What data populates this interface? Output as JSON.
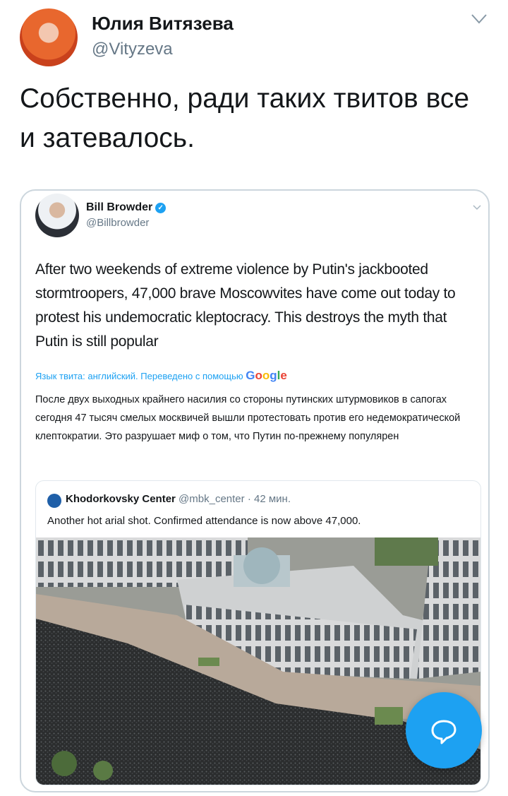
{
  "tweet": {
    "author_name": "Юлия Витязева",
    "author_handle": "@Vityzeva",
    "text": "Собственно, ради таких твитов все и затевалось."
  },
  "quoted": {
    "author_name": "Bill Browder",
    "author_handle": "@Billbrowder",
    "text": "After two weekends of extreme violence by Putin's jackbooted stormtroopers, 47,000 brave Moscowvites have come out today to protest his undemocratic kleptocracy. This destroys the myth that Putin is still popular",
    "translate_label": "Язык твита: английский. Переведено с помощью",
    "translate_provider": "Google",
    "translation": "После двух выходных крайнего насилия со стороны путинских штурмовиков в сапогах сегодня 47 тысяч смелых москвичей вышли протестовать против его недемократической клептократии. Это разрушает миф о том, что Путин по-прежнему популярен",
    "nested": {
      "author_name": "Khodorkovsky Center",
      "author_handle": "@mbk_center",
      "time": "· 42 мин.",
      "text": "Another hot arial shot. Confirmed attendance is now above 47,000."
    }
  },
  "colors": {
    "accent": "#1da1f2",
    "secondary_text": "#657786",
    "border": "#ccd6dd"
  },
  "icons": {
    "fab": "reply-bubble-icon",
    "menu": "chevron-down-icon",
    "verified": "verified-badge-icon"
  }
}
